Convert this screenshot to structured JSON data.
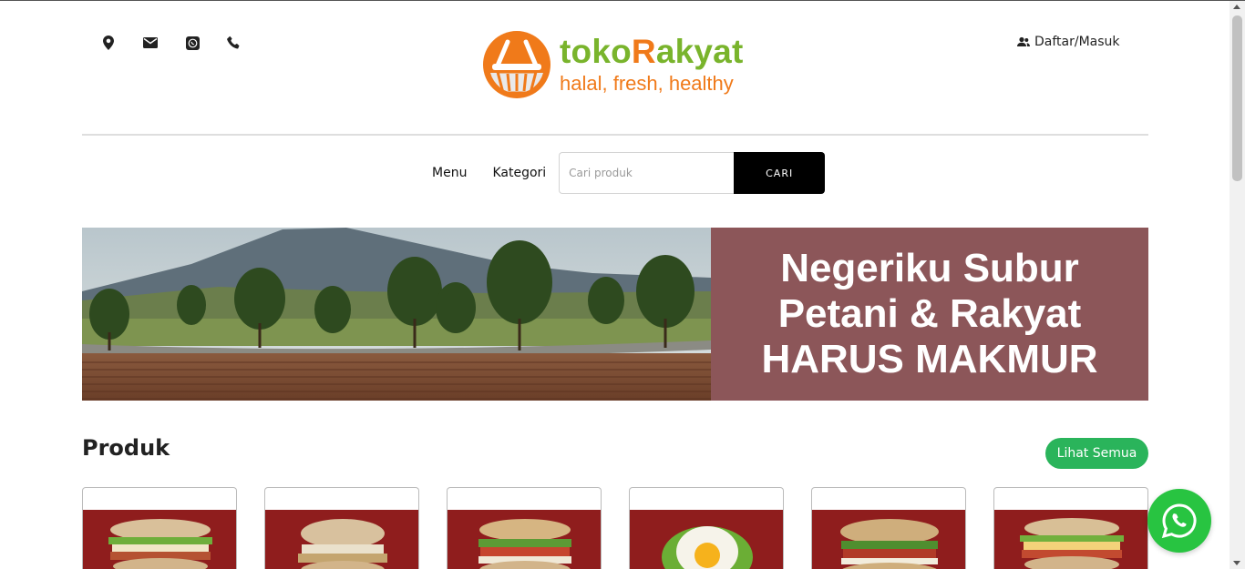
{
  "header": {
    "contact_icons": [
      "map-pin-icon",
      "envelope-icon",
      "whatsapp-icon",
      "phone-icon"
    ],
    "logo": {
      "name_part1": "toko",
      "name_part2": "R",
      "name_part3": "akyat",
      "tagline": "halal, fresh, healthy"
    },
    "account_label": "Daftar/Masuk"
  },
  "nav": {
    "menu_label": "Menu",
    "category_label": "Kategori",
    "search_placeholder": "Cari produk",
    "search_button": "CARI"
  },
  "banner": {
    "line1": "Negeriku Subur",
    "line2": "Petani & Rakyat",
    "line3": "HARUS MAKMUR"
  },
  "products": {
    "title": "Produk",
    "see_all": "Lihat Semua",
    "count_visible": 6
  },
  "colors": {
    "brand_green": "#79b42c",
    "brand_orange": "#f07a1a",
    "button_green": "#2ab45b",
    "banner_panel": "#8c5659",
    "product_bg": "#8f1d1d",
    "whatsapp": "#28c441"
  }
}
